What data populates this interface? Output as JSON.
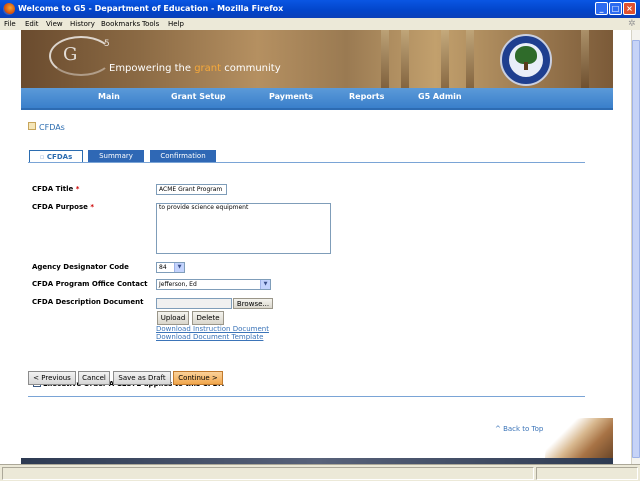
{
  "window": {
    "title": "Welcome to G5 - Department of Education - Mozilla Firefox",
    "min": "_",
    "max": "□",
    "close": "×"
  },
  "menu": [
    "File",
    "Edit",
    "View",
    "History",
    "Bookmarks",
    "Tools",
    "Help"
  ],
  "banner": {
    "logo_text": "G",
    "logo_sup": "5",
    "tagline_a": "Empowering the ",
    "tagline_grant": "grant",
    "tagline_b": " community"
  },
  "nav": [
    "Main",
    "Grant Setup",
    "Payments",
    "Reports",
    "G5 Admin"
  ],
  "page_title": "CFDAs",
  "tabs": [
    "CFDAs",
    "Summary",
    "Confirmation"
  ],
  "form": {
    "title_label": "CFDA Title",
    "title_value": "ACME Grant Program",
    "purpose_label": "CFDA Purpose",
    "purpose_value": "to provide science equipment",
    "agency_label": "Agency Designator Code",
    "agency_value": "84",
    "contact_label": "CFDA Program Office Contact",
    "contact_value": "Jefferson, Ed",
    "doc_label": "CFDA Description Document",
    "browse": "Browse...",
    "upload": "Upload",
    "delete": "Delete",
    "download_instruction": "Download Instruction Document",
    "download_template": "Download Document Template",
    "exec_order": "Executive Order A-12372 applies to this CFDA",
    "required_mark": "*"
  },
  "actions": {
    "previous": "< Previous",
    "cancel": "Cancel",
    "save_draft": "Save as Draft",
    "continue": "Continue >"
  },
  "back_to_top": "^ Back to Top"
}
